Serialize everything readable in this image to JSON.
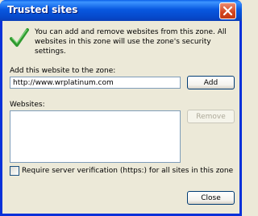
{
  "window": {
    "title": "Trusted sites",
    "close_icon": "close-icon"
  },
  "description": "You can add and remove websites from this zone. All websites in this zone will use the zone's security settings.",
  "icons": {
    "info": "checkmark-icon"
  },
  "add_section": {
    "label": "Add this website to the zone:",
    "url_value": "http://www.wrplatinum.com",
    "add_button": "Add"
  },
  "websites_section": {
    "label": "Websites:",
    "items": [],
    "remove_button": "Remove"
  },
  "verification": {
    "label": "Require server verification (https:) for all sites in this zone",
    "checked": false
  },
  "close_button": "Close",
  "colors": {
    "title_bar": "#0a5fe8",
    "dialog_bg": "#ece9d8",
    "check_green": "#3aa83a"
  }
}
